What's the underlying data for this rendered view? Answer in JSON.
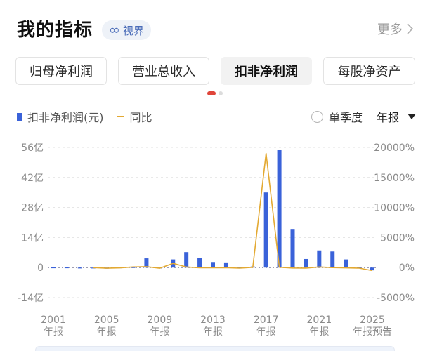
{
  "header": {
    "title": "我的指标",
    "badge": {
      "icon": "infinity-icon",
      "label": "视界"
    },
    "more_label": "更多"
  },
  "tabs": [
    {
      "label": "归母净利润",
      "active": false
    },
    {
      "label": "营业总收入",
      "active": false
    },
    {
      "label": "扣非净利润",
      "active": true
    },
    {
      "label": "每股净资产",
      "active": false
    }
  ],
  "pager": {
    "pages": 2,
    "current": 1
  },
  "legend": {
    "bar_label": "扣非净利润(元)",
    "line_label": "同比"
  },
  "controls": {
    "quarter_label": "单季度",
    "period_label": "年报"
  },
  "colors": {
    "bar": "#3a62d9",
    "line": "#e3a932",
    "accent": "#e0453a"
  },
  "chart_data": {
    "type": "bar+line",
    "x": [
      2001,
      2002,
      2003,
      2004,
      2005,
      2006,
      2007,
      2008,
      2009,
      2010,
      2011,
      2012,
      2013,
      2014,
      2015,
      2016,
      2017,
      2018,
      2019,
      2020,
      2021,
      2022,
      2023,
      2024,
      2025
    ],
    "x_tick_labels": [
      {
        "year": "2001",
        "sub": "年报"
      },
      {
        "year": "2005",
        "sub": "年报"
      },
      {
        "year": "2009",
        "sub": "年报"
      },
      {
        "year": "2013",
        "sub": "年报"
      },
      {
        "year": "2017",
        "sub": "年报"
      },
      {
        "year": "2021",
        "sub": "年报"
      },
      {
        "year": "2025",
        "sub": "年报预告"
      }
    ],
    "series": [
      {
        "name": "扣非净利润(元)",
        "type": "bar",
        "axis": "left",
        "unit": "亿",
        "values": [
          0.1,
          0.1,
          0,
          0,
          -0.5,
          0.1,
          0.2,
          4.3,
          0,
          3.8,
          7.2,
          4.5,
          2.6,
          2.4,
          0.3,
          0.5,
          35,
          55,
          18,
          4,
          8,
          7.5,
          3.8,
          0.3,
          -1.3
        ]
      },
      {
        "name": "同比",
        "type": "line",
        "axis": "right",
        "unit": "%",
        "values": [
          null,
          null,
          null,
          0,
          -100,
          -50,
          100,
          150,
          -100,
          700,
          100,
          -40,
          -40,
          -10,
          -90,
          50,
          19000,
          60,
          -65,
          -80,
          100,
          -5,
          -50,
          -90,
          -500
        ]
      }
    ],
    "left_axis": {
      "ticks": [
        "56亿",
        "42亿",
        "28亿",
        "14亿",
        "0",
        "-14亿"
      ],
      "range": [
        -14,
        56
      ]
    },
    "right_axis": {
      "ticks": [
        "20000%",
        "15000%",
        "10000%",
        "5000%",
        "0%",
        "-5000%"
      ],
      "range": [
        -5000,
        20000
      ]
    },
    "grid": true
  }
}
